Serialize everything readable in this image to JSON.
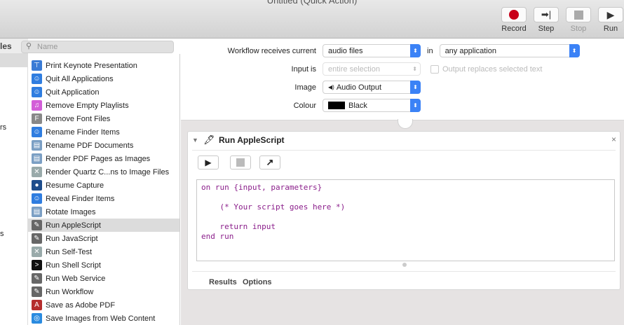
{
  "window": {
    "title": "Untitled (Quick Action)"
  },
  "toolbar": {
    "record": "Record",
    "step": "Step",
    "stop": "Stop",
    "run": "Run"
  },
  "library": {
    "header_partial": "les",
    "partial_items": [
      "rs",
      "s"
    ]
  },
  "search": {
    "placeholder": "Name"
  },
  "actions": [
    {
      "label": "Print Keynote Presentation",
      "icon": "keynote-icon"
    },
    {
      "label": "Quit All Applications",
      "icon": "finder-icon"
    },
    {
      "label": "Quit Application",
      "icon": "finder-icon"
    },
    {
      "label": "Remove Empty Playlists",
      "icon": "itunes-icon"
    },
    {
      "label": "Remove Font Files",
      "icon": "font-book-icon"
    },
    {
      "label": "Rename Finder Items",
      "icon": "finder-icon"
    },
    {
      "label": "Rename PDF Documents",
      "icon": "preview-icon"
    },
    {
      "label": "Render PDF Pages as Images",
      "icon": "preview-icon"
    },
    {
      "label": "Render Quartz C...ns to Image Files",
      "icon": "tools-icon"
    },
    {
      "label": "Resume Capture",
      "icon": "quicktime-icon"
    },
    {
      "label": "Reveal Finder Items",
      "icon": "finder-icon"
    },
    {
      "label": "Rotate Images",
      "icon": "preview-icon"
    },
    {
      "label": "Run AppleScript",
      "icon": "automator-icon",
      "selected": true
    },
    {
      "label": "Run JavaScript",
      "icon": "automator-icon"
    },
    {
      "label": "Run Self-Test",
      "icon": "tools-icon"
    },
    {
      "label": "Run Shell Script",
      "icon": "terminal-icon"
    },
    {
      "label": "Run Web Service",
      "icon": "automator-icon"
    },
    {
      "label": "Run Workflow",
      "icon": "automator-icon"
    },
    {
      "label": "Save as Adobe PDF",
      "icon": "adobe-pdf-icon"
    },
    {
      "label": "Save Images from Web Content",
      "icon": "safari-icon"
    }
  ],
  "workflow": {
    "receives_label": "Workflow receives current",
    "receives_value": "audio files",
    "in_label": "in",
    "in_value": "any application",
    "input_label": "Input is",
    "input_value": "entire selection",
    "output_replaces": "Output replaces selected text",
    "image_label": "Image",
    "image_value": "Audio Output",
    "colour_label": "Colour",
    "colour_value": "Black",
    "colour_swatch": "#000000"
  },
  "action_card": {
    "title": "Run AppleScript",
    "code": "on run {input, parameters}\n\n    (* Your script goes here *)\n\n    return input\nend run",
    "tabs": [
      "Results",
      "Options"
    ]
  }
}
